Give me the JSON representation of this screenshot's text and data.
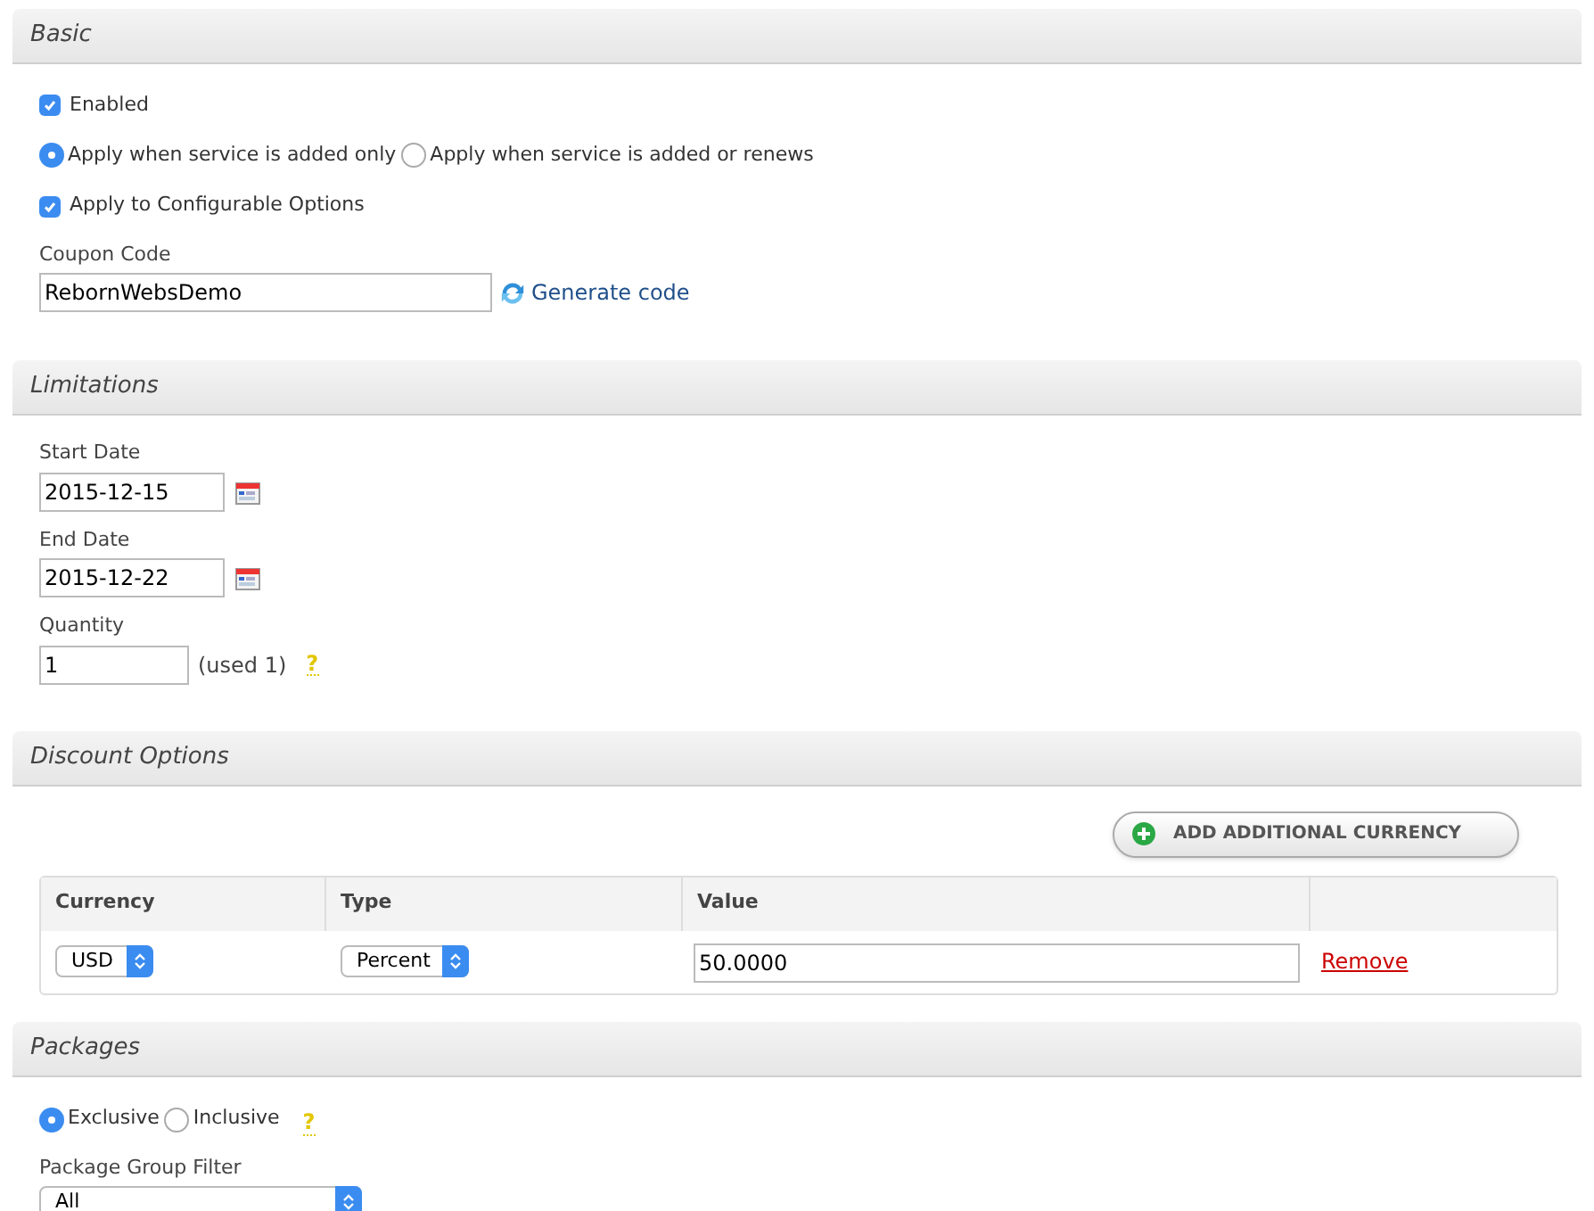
{
  "basic": {
    "title": "Basic",
    "enabled": {
      "label": "Enabled",
      "checked": true
    },
    "apply_when": [
      {
        "label": "Apply when service is added only",
        "selected": true
      },
      {
        "label": "Apply when service is added or renews",
        "selected": false
      }
    ],
    "configurable": {
      "label": "Apply to Configurable Options",
      "checked": true
    },
    "coupon_code": {
      "label": "Coupon Code",
      "value": "RebornWebsDemo"
    },
    "generate": "Generate code"
  },
  "limitations": {
    "title": "Limitations",
    "start_date": {
      "label": "Start Date",
      "value": "2015-12-15"
    },
    "end_date": {
      "label": "End Date",
      "value": "2015-12-22"
    },
    "quantity": {
      "label": "Quantity",
      "value": "1",
      "used": "(used 1)",
      "help": "?"
    }
  },
  "discount": {
    "title": "Discount Options",
    "add_button": "ADD ADDITIONAL CURRENCY",
    "columns": [
      "Currency",
      "Type",
      "Value"
    ],
    "rows": [
      {
        "currency": "USD",
        "type": "Percent",
        "value": "50.0000",
        "remove": "Remove"
      }
    ]
  },
  "packages": {
    "title": "Packages",
    "mode": [
      {
        "label": "Exclusive",
        "selected": true
      },
      {
        "label": "Inclusive",
        "selected": false
      }
    ],
    "help": "?",
    "group_filter": {
      "label": "Package Group Filter",
      "value": "All"
    }
  }
}
